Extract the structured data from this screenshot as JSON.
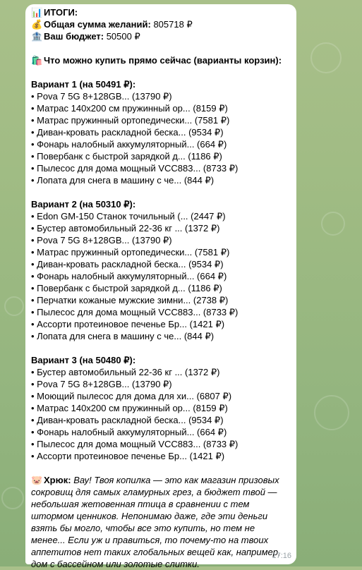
{
  "summary": {
    "title_icon": "📊",
    "title": "ИТОГИ:",
    "total_icon": "💰",
    "total_label": "Общая сумма желаний:",
    "total_value": "805718 ₽",
    "budget_icon": "🏦",
    "budget_label": "Ваш бюджет:",
    "budget_value": "50500 ₽"
  },
  "buy_now": {
    "icon": "🛍️",
    "title": "Что можно купить прямо сейчас (варианты корзин):"
  },
  "variants": [
    {
      "title": "Вариант 1 (на 50491 ₽):",
      "items": [
        "• Pova 7 5G 8+128GB... (13790 ₽)",
        "• Матрас 140x200 см пружинный ор... (8159 ₽)",
        "• Матрас пружинный ортопедически... (7581 ₽)",
        "• Диван-кровать раскладной беска... (9534 ₽)",
        "• Фонарь налобный аккумуляторный... (664 ₽)",
        "• Повербанк с быстрой зарядкой д... (1186 ₽)",
        "• Пылесос для дома мощный VCC883... (8733 ₽)",
        "• Лопата для снега в машину с че... (844 ₽)"
      ]
    },
    {
      "title": "Вариант 2 (на 50310 ₽):",
      "items": [
        "• Edon GM-150 Станок точильный (... (2447 ₽)",
        "• Бустер автомобильный 22-36 кг ... (1372 ₽)",
        "• Pova 7 5G 8+128GB... (13790 ₽)",
        "• Матрас пружинный ортопедически... (7581 ₽)",
        "• Диван-кровать раскладной беска... (9534 ₽)",
        "• Фонарь налобный аккумуляторный... (664 ₽)",
        "• Повербанк с быстрой зарядкой д... (1186 ₽)",
        "• Перчатки кожаные мужские зимни... (2738 ₽)",
        "• Пылесос для дома мощный VCC883... (8733 ₽)",
        "• Ассорти протеиновое печенье Бр... (1421 ₽)",
        "• Лопата для снега в машину с че... (844 ₽)"
      ]
    },
    {
      "title": "Вариант 3 (на 50480 ₽):",
      "items": [
        "• Бустер автомобильный 22-36 кг ... (1372 ₽)",
        "• Pova 7 5G 8+128GB... (13790 ₽)",
        "• Моющий пылесос для дома для хи... (6807 ₽)",
        "• Матрас 140x200 см пружинный ор... (8159 ₽)",
        "• Диван-кровать раскладной беска... (9534 ₽)",
        "• Фонарь налобный аккумуляторный... (664 ₽)",
        "• Пылесос для дома мощный VCC883... (8733 ₽)",
        "• Ассорти протеиновое печенье Бр... (1421 ₽)"
      ]
    }
  ],
  "comment": {
    "icon": "🐷",
    "author": "Хрюк:",
    "text": "Вау! Твоя копилка — это как магазин призовых сокровищ для самых гламурных грез, а бюджет твой — небольшая жетовенная птица в сравнении с тем штормом ценников. Непонимаю даже, где эти деньги взять бы могло, чтобы все это купить, но тем не менее... Если уж и правиться, то почему-то на твоих аппетитов нет таких глобальных вещей как, например, дом с бассейном или золотые слитки."
  },
  "time": "17:16",
  "colors": {
    "background": "#9fbb83",
    "bubble": "#ffffff",
    "time": "#9aa3a8"
  }
}
